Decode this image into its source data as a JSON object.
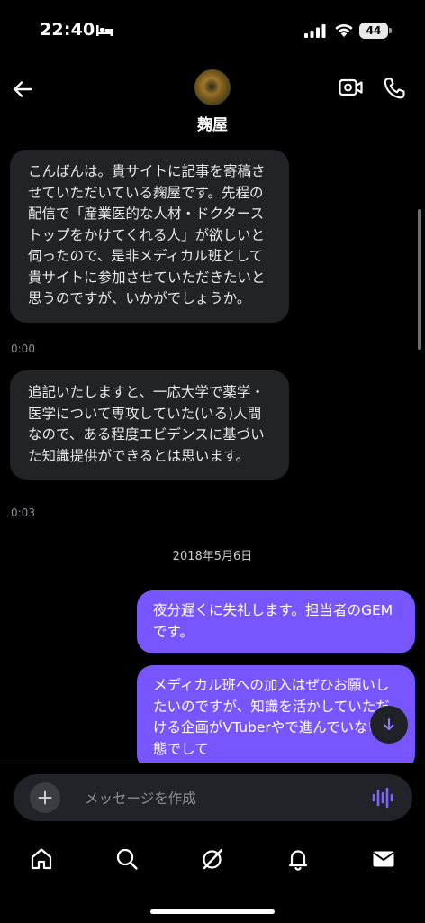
{
  "status_bar": {
    "time": "22:40",
    "battery": "44"
  },
  "header": {
    "name": "麹屋"
  },
  "messages": [
    {
      "text": "こんばんは。貴サイトに記事を寄稿させていただいている麹屋です。先程の配信で「産業医的な人材・ドクターストップをかけてくれる人」が欲しいと伺ったので、是非メディカル班として貴サイトに参加させていただきたいと思うのですが、いかがでしょうか。",
      "time": "0:00"
    },
    {
      "text": "追記いたしますと、一応大学で薬学・医学について専攻していた(いる)人間なので、ある程度エビデンスに基づいた知識提供ができるとは思います。",
      "time": "0:03"
    }
  ],
  "date_separator": "2018年5月6日",
  "replies": [
    {
      "text": "夜分遅くに失礼します。担当者のGEMです。"
    },
    {
      "text": "メディカル班への加入はぜひお願いしたいのですが、知識を活かしていただける企画がVTuberやで進んでいない状態でして"
    }
  ],
  "composer": {
    "placeholder": "メッセージを作成"
  },
  "colors": {
    "accent": "#7856ff",
    "incoming_bubble": "#212327",
    "background": "#000000"
  },
  "icons": {
    "back": "arrow-left-icon",
    "video": "video-call-icon",
    "phone": "phone-icon",
    "plus": "plus-icon",
    "voice": "voice-wave-icon",
    "scroll_down": "arrow-down-icon",
    "tabs": [
      "home-icon",
      "search-icon",
      "grok-icon",
      "bell-icon",
      "mail-icon"
    ]
  }
}
